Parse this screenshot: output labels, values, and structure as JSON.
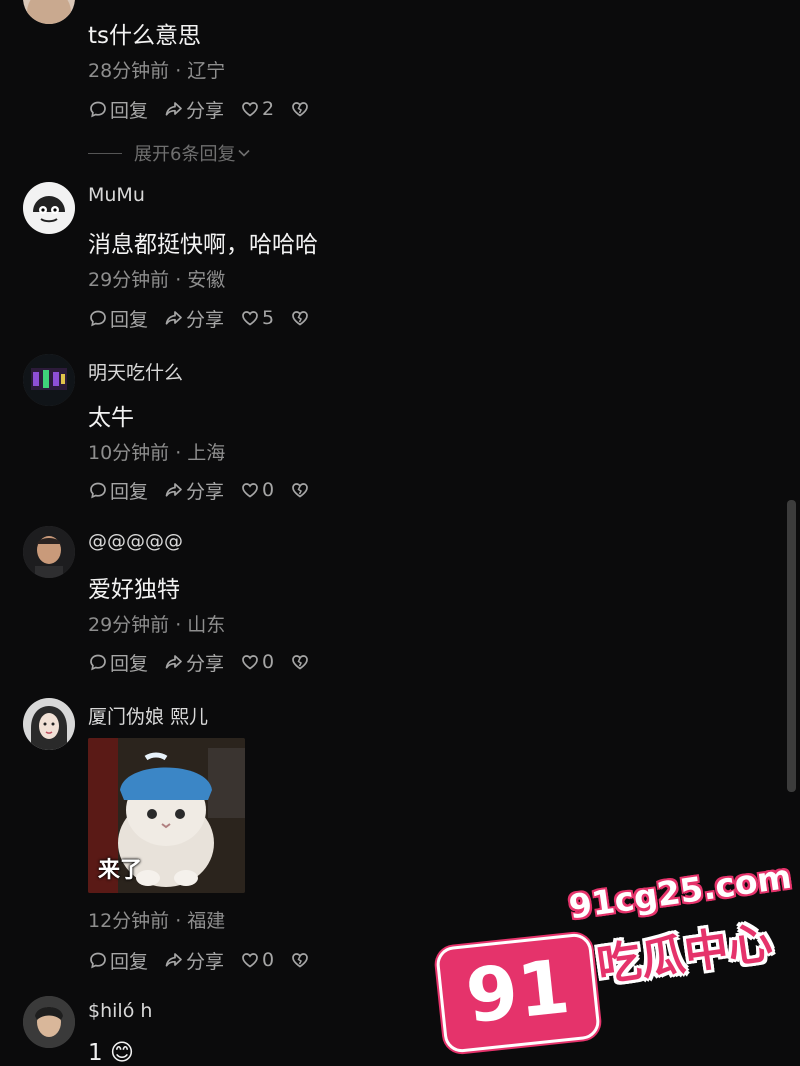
{
  "comments": [
    {
      "username": "",
      "text": "ts什么意思",
      "meta": "28分钟前 · 辽宁",
      "reply_label": "回复",
      "share_label": "分享",
      "likes": "2",
      "expand_label": "展开6条回复"
    },
    {
      "username": "MuMu",
      "text": "消息都挺快啊，哈哈哈",
      "meta": "29分钟前 · 安徽",
      "reply_label": "回复",
      "share_label": "分享",
      "likes": "5"
    },
    {
      "username": "明天吃什么",
      "text": "太牛",
      "meta": "10分钟前 · 上海",
      "reply_label": "回复",
      "share_label": "分享",
      "likes": "0"
    },
    {
      "username": "@@@@@",
      "text": "爱好独特",
      "meta": "29分钟前 · 山东",
      "reply_label": "回复",
      "share_label": "分享",
      "likes": "0"
    },
    {
      "username": "厦门伪娘 熙儿",
      "sticker_caption": "来了",
      "meta": "12分钟前 · 福建",
      "reply_label": "回复",
      "share_label": "分享",
      "likes": "0"
    },
    {
      "username": "$hiló h",
      "text": "1 😊"
    }
  ],
  "icons": {
    "reply": "comment-bubble-icon",
    "share": "share-arrow-icon",
    "like": "heart-icon",
    "dislike": "broken-heart-icon",
    "expand": "chevron-down-icon"
  },
  "watermark": {
    "badge": "91",
    "domain": "91cg25.com",
    "name": "吃瓜中心"
  },
  "colors": {
    "background": "#0b0b0c",
    "watermark_pink": "#e5336b"
  }
}
